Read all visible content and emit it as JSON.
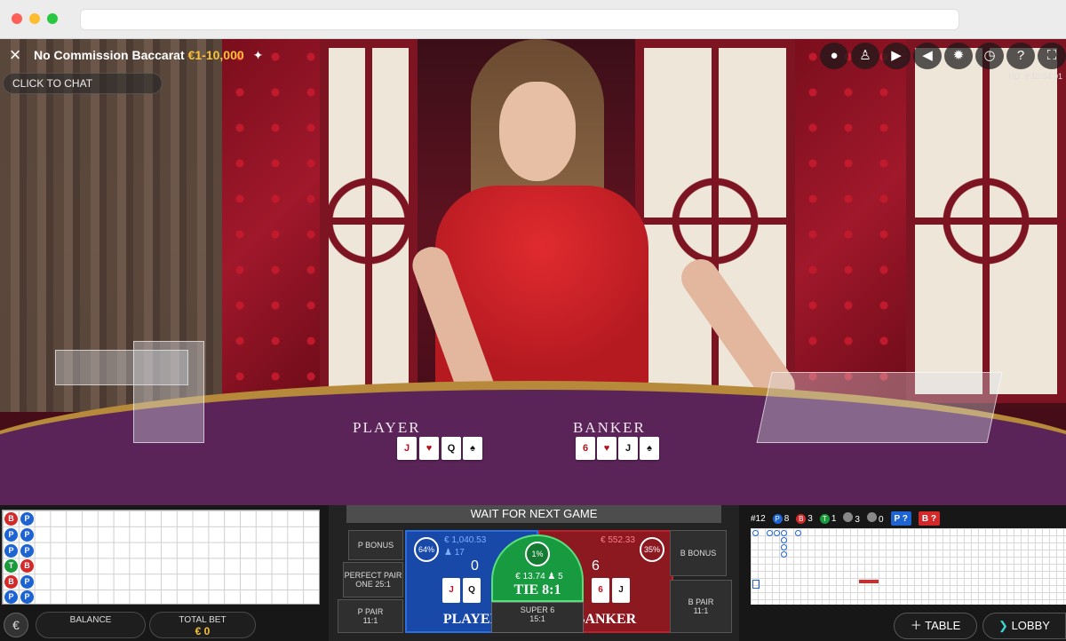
{
  "header": {
    "title": "No Commission Baccarat",
    "limits": "€1-10,000",
    "chat_label": "CLICK TO CHAT",
    "hd_label": "HD",
    "time_label": "# 13:04:01"
  },
  "icons": [
    "close-icon",
    "pin-icon",
    "chat-bubbles-icon",
    "accessibility-icon",
    "video-camera-icon",
    "volume-icon",
    "gear-icon",
    "history-icon",
    "help-icon",
    "fullscreen-icon"
  ],
  "table": {
    "player_label": "PLAYER",
    "banker_label": "BANKER"
  },
  "bead_road": [
    "B",
    "P",
    "P",
    "P",
    "T",
    "B",
    "B",
    "P",
    "P",
    "P"
  ],
  "betting": {
    "status": "WAIT FOR NEXT GAME",
    "p_bonus": "P BONUS",
    "perfect_pair_line1": "PERFECT PAIR",
    "perfect_pair_line2": "ONE 25:1",
    "p_pair": "P PAIR",
    "p_pair_odds": "11:1",
    "b_bonus": "B BONUS",
    "b_pair": "B PAIR",
    "b_pair_odds": "11:1",
    "player": {
      "pct": "64%",
      "amount": "€ 1,040.53",
      "players": "17",
      "score": "0",
      "label": "PLAYER",
      "cards": [
        "J",
        "Q"
      ]
    },
    "banker": {
      "pct": "35%",
      "amount": "€ 552.33",
      "players": "",
      "score": "6",
      "label": "BANKER",
      "cards": [
        "6",
        "J"
      ]
    },
    "tie": {
      "pct": "1%",
      "amount": "€ 13.74",
      "players": "5",
      "label": "TIE 8:1"
    },
    "super6": {
      "label": "SUPER 6",
      "odds": "15:1"
    }
  },
  "road_stats": {
    "games": "#12",
    "player_count": "8",
    "banker_count": "3",
    "tie_count": "1",
    "pair1": "3",
    "pair2": "0",
    "player_ask": "P ?",
    "banker_ask": "B ?"
  },
  "footer": {
    "currency": "€",
    "balance_label": "BALANCE",
    "balance_value": "",
    "total_bet_label": "TOTAL BET",
    "total_bet_value": "€ 0",
    "table_btn": "TABLE",
    "lobby_btn": "LOBBY"
  },
  "colors": {
    "player": "#1848a8",
    "banker": "#8c1820",
    "tie": "#189a40",
    "gold": "#f6c33a"
  }
}
